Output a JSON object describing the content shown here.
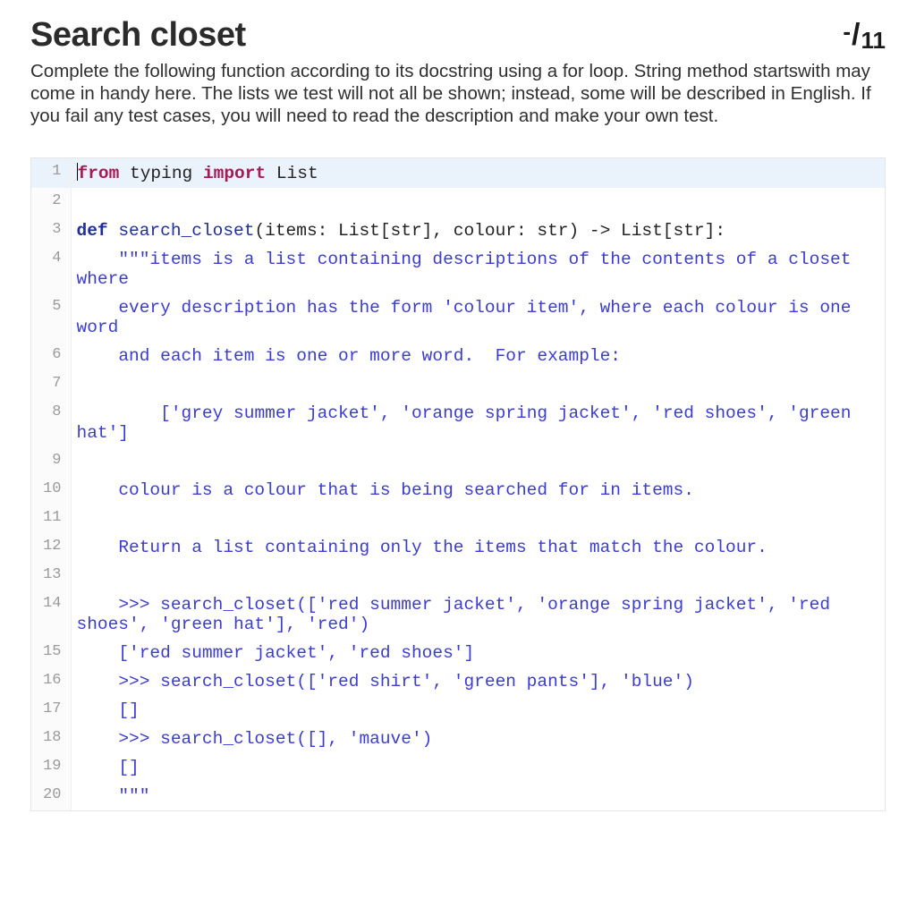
{
  "header": {
    "title": "Search closet",
    "score_numer": "-",
    "score_denom": "11"
  },
  "description": "Complete the following function according to its docstring using a for loop. String method startswith may come in handy here. The lists we test will not all be shown; instead, some will be described in English. If you fail any test cases, you will need to read the description and make your own test.",
  "code": {
    "l1_from": "from",
    "l1_mod": " typing ",
    "l1_import": "import",
    "l1_list": " List",
    "l3_def": "def",
    "l3_sig_a": " ",
    "l3_fn": "search_closet",
    "l3_sig_b": "(items: List[str], colour: str) -> List[str]:",
    "l4": "    \"\"\"items is a list containing descriptions of the contents of a closet where",
    "l5": "    every description has the form 'colour item', where each colour is one word",
    "l6": "    and each item is one or more word.  For example:",
    "l7": "",
    "l8": "        ['grey summer jacket', 'orange spring jacket', 'red shoes', 'green hat']",
    "l9": "",
    "l10": "    colour is a colour that is being searched for in items.",
    "l11": "",
    "l12": "    Return a list containing only the items that match the colour.",
    "l13": "",
    "l14": "    >>> search_closet(['red summer jacket', 'orange spring jacket', 'red shoes', 'green hat'], 'red')",
    "l15": "    ['red summer jacket', 'red shoes']",
    "l16": "    >>> search_closet(['red shirt', 'green pants'], 'blue')",
    "l17": "    []",
    "l18": "    >>> search_closet([], 'mauve')",
    "l19": "    []",
    "l20": "    \"\"\"",
    "ln1": "1",
    "ln2": "2",
    "ln3": "3",
    "ln4": "4",
    "ln5": "5",
    "ln6": "6",
    "ln7": "7",
    "ln8": "8",
    "ln9": "9",
    "ln10": "10",
    "ln11": "11",
    "ln12": "12",
    "ln13": "13",
    "ln14": "14",
    "ln15": "15",
    "ln16": "16",
    "ln17": "17",
    "ln18": "18",
    "ln19": "19",
    "ln20": "20"
  }
}
